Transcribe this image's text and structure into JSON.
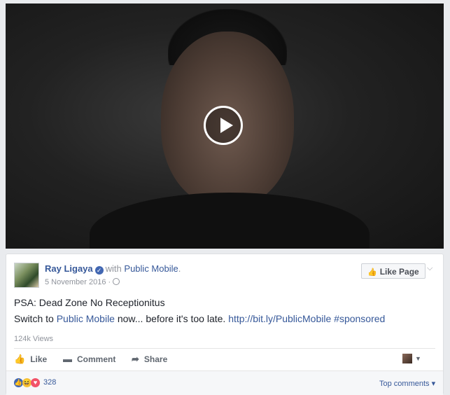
{
  "video": {
    "play_icon": "play-icon"
  },
  "post": {
    "author": "Ray Ligaya",
    "verified_icon": "verified-icon",
    "with_text": "with",
    "page": "Public Mobile",
    "page_suffix": ".",
    "date": "5 November 2016",
    "date_separator": "·",
    "like_page_label": "Like Page",
    "line1": "PSA: Dead Zone No Receptionitus",
    "line2_prefix": "Switch to ",
    "line2_link": "Public Mobile",
    "line2_middle": " now... before it's too late. ",
    "line2_url": "http://bit.ly/PublicMobile",
    "line2_space": " ",
    "line2_hashtag": "#sponsored",
    "views": "124k Views"
  },
  "actions": {
    "like": "Like",
    "comment": "Comment",
    "share": "Share"
  },
  "reactions": {
    "count": "328",
    "top_comments": "Top comments ▾"
  },
  "colors": {
    "link": "#365899",
    "muted": "#90949c",
    "brand": "#4267b2"
  }
}
